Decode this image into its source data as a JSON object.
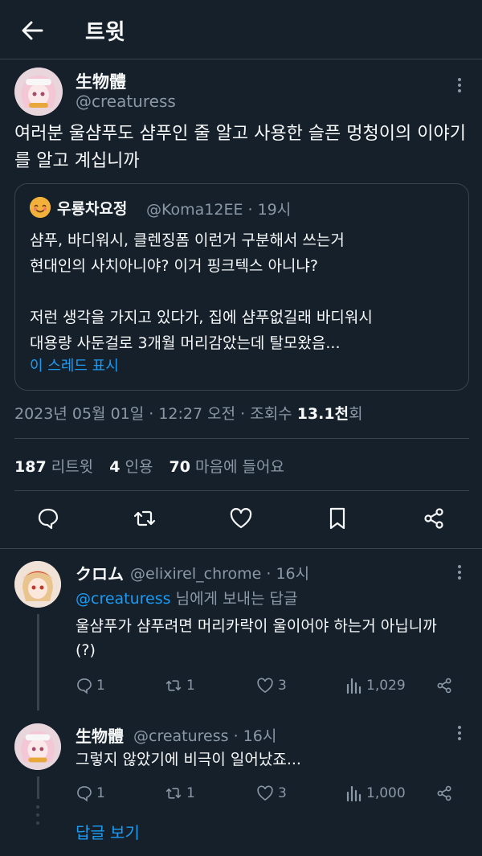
{
  "header": {
    "title": "트윗"
  },
  "tweet": {
    "name": "生物體",
    "handle": "@creaturess",
    "text": "여러분 울샴푸도 샴푸인 줄 알고 사용한 슬픈 멍청이의 이야기를 알고 계십니까",
    "quote": {
      "name": "우룡차요정",
      "handle": "@Koma12EE · 19시",
      "text": "샴푸, 바디워시, 클렌징폼 이런거 구분해서 쓰는거\n현대인의 사치아니야? 이거 핑크텍스 아니냐?\n\n저런 생각을 가지고 있다가, 집에 샴푸없길래 바디워시\n대용량 사둔걸로 3개월 머리감았는데 탈모왔음...",
      "show_thread": "이 스레드 표시"
    },
    "meta": {
      "datetime": "2023년 05월 01일 · 12:27 오전 · 조회수 ",
      "views": "13.1천",
      "views_suffix": "회"
    },
    "stats": {
      "retweets": "187",
      "retweets_label": "리트윗",
      "quotes": "4",
      "quotes_label": "인용",
      "likes": "70",
      "likes_label": "마음에 들어요"
    }
  },
  "replies": [
    {
      "name": "クロム",
      "handle": "@elixirel_chrome · 16시",
      "reply_to_handle": "@creaturess",
      "reply_to_suffix": " 님에게 보내는 답글",
      "text": "울샴푸가 샴푸려면 머리카락이 울이어야 하는거 아닙니까(?)",
      "replies": "1",
      "retweets": "1",
      "likes": "3",
      "views": "1,029"
    },
    {
      "name": "生物體",
      "handle": "@creaturess · 16시",
      "text": "그렇지 않았기에 비극이 일어났죠...",
      "replies": "1",
      "retweets": "1",
      "likes": "3",
      "views": "1,000"
    }
  ],
  "show_replies": "답글 보기",
  "colors": {
    "background": "#15202b",
    "accent": "#1d9bf0",
    "muted": "#8b98a5",
    "border": "#38444d"
  }
}
